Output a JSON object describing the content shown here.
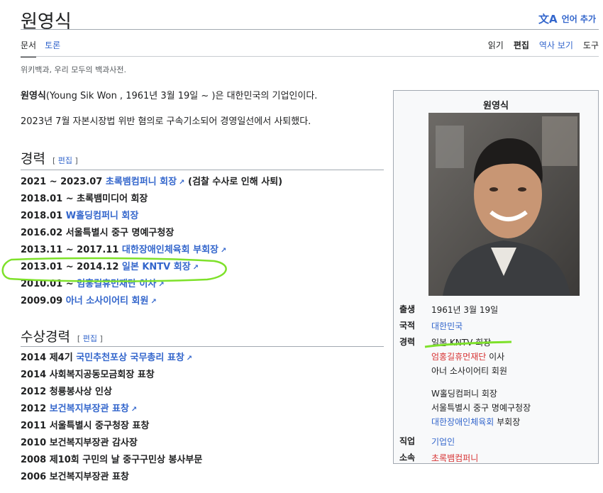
{
  "page": {
    "title": "원영식",
    "language_button": "언어 추가",
    "language_icon": "translate-icon",
    "tabs_left": [
      "문서",
      "토론"
    ],
    "tabs_right": [
      "읽기",
      "편집",
      "역사 보기",
      "도구"
    ],
    "tagline": "위키백과, 우리 모두의 백과사전."
  },
  "intro": {
    "name": "원영식",
    "line1_rest": "(Young Sik Won , 1961년 3월 19일 ~ )은 대한민국의 기업인이다.",
    "line2": "2023년 7월 자본시장법 위반 혐의로 구속기소되어 경영일선에서 사퇴했다."
  },
  "career": {
    "heading": "경력",
    "edit": "편집",
    "items": [
      {
        "pre": "2021 ~ 2023.07 ",
        "link": "초록뱀컴퍼니 회장",
        "post": " (검찰 수사로 인해 사퇴)"
      },
      {
        "pre": "2018.01 ~ 초록뱀미디어 회장",
        "link": "",
        "post": ""
      },
      {
        "pre": "2018.01 ",
        "link": "W홀딩컴퍼니 회장",
        "post": ""
      },
      {
        "pre": "2016.02 서울특별시 중구 명예구청장",
        "link": "",
        "post": ""
      },
      {
        "pre": "2013.11 ~ 2017.11 ",
        "link": "대한장애인체육회 부회장",
        "post": ""
      },
      {
        "pre": "2013.01 ~ 2014.12 ",
        "link": "일본 KNTV 회장",
        "post": ""
      },
      {
        "pre": "2010.01 ~ ",
        "link": "엄홍길휴먼재단 이사",
        "post": ""
      },
      {
        "pre": "2009.09 ",
        "link": "아너 소사이어티 회원",
        "post": ""
      }
    ]
  },
  "awards": {
    "heading": "수상경력",
    "edit": "편집",
    "items": [
      {
        "pre": "2014 제4기 ",
        "link": "국민추천포상 국무총리 표창"
      },
      {
        "pre": "2014 사회복지공동모금회장 표창",
        "link": ""
      },
      {
        "pre": "2012 청룡봉사상 인상",
        "link": ""
      },
      {
        "pre": "2012 ",
        "link": "보건복지부장관 표창"
      },
      {
        "pre": "2011 서울특별시 중구청장 표창",
        "link": ""
      },
      {
        "pre": "2010 보건복지부장관 감사장",
        "link": ""
      },
      {
        "pre": "2008 제10회 구민의 날 중구구민상 봉사부문",
        "link": ""
      },
      {
        "pre": "2006 보건복지부장관 표창",
        "link": ""
      }
    ]
  },
  "infobox": {
    "title": "원영식",
    "birth_label": "출생",
    "birth": "1961년 3월 19일",
    "nationality_label": "국적",
    "nationality": "대한민국",
    "career_label": "경력",
    "career": [
      "일본 KNTV 회장",
      "엄홍길휴먼재단 이사",
      "아너 소사이어티 회원",
      "W홀딩컴퍼니 회장",
      "서울특별시 중구 명예구청장",
      "대한장애인체육회 부회장"
    ],
    "career_director_suffix": " 이사",
    "career_vice_suffix": " 부회장",
    "career_vice_link": "대한장애인체육회",
    "career_director_link": "엄홍길휴먼재단",
    "job_label": "직업",
    "job": "기업인",
    "affil_label": "소속",
    "affil": "초록뱀컴퍼니"
  },
  "colors": {
    "link": "#3366cc",
    "redlink": "#d73333",
    "highlight_marker": "#7ee12a"
  }
}
